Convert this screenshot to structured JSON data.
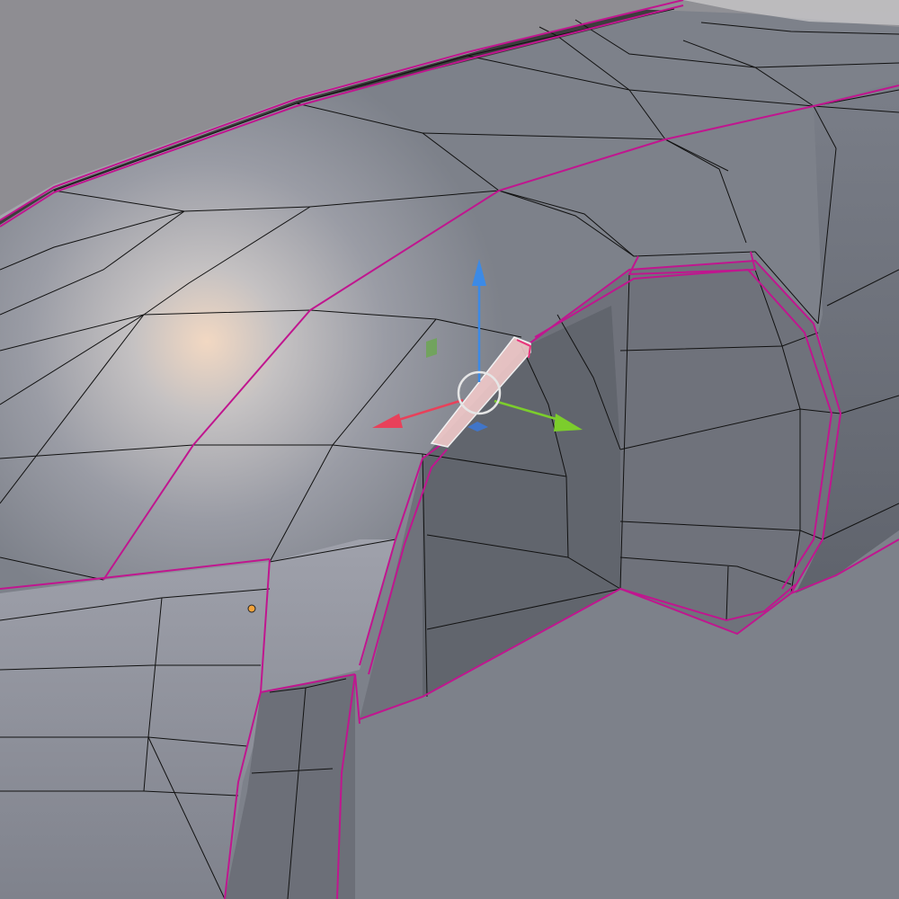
{
  "viewport": {
    "background_color": "#3d3d3d",
    "grid_axis_color": "#7aa32a",
    "mesh_base_color": "#8a8e98",
    "mesh_highlight_color": "#f3d6bd",
    "wire_color": "#101010",
    "seam_color": "#c0168f",
    "selected_face_color": "#f1c9c9"
  },
  "gizmo": {
    "x_axis": {
      "color": "#e8415a",
      "icon": "x-axis-arrow"
    },
    "y_axis": {
      "color": "#7ccd2c",
      "icon": "y-axis-arrow"
    },
    "z_axis": {
      "color": "#3c8ae6",
      "icon": "z-axis-arrow"
    },
    "center_ring_color": "#e6e6e6",
    "plane_handles": [
      "xz-plane-handle",
      "xy-plane-handle"
    ]
  },
  "object_origin": {
    "color": "#f2a23a",
    "icon": "origin-dot"
  }
}
